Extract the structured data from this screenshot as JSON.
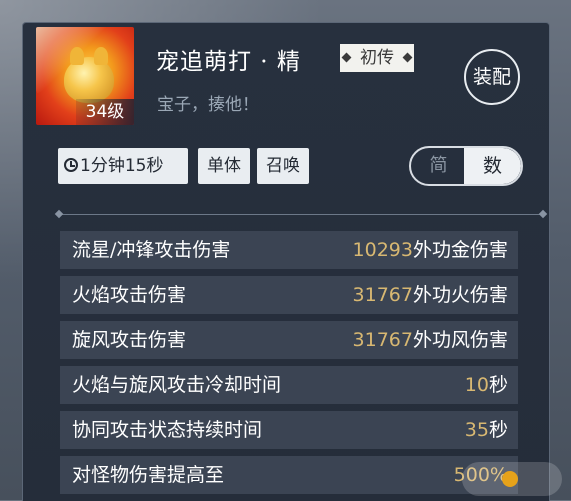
{
  "skill": {
    "level": "34级",
    "name": "宠追萌打 · 精",
    "tag": "初传",
    "description": "宝子，揍他！",
    "equip_button": "装配",
    "portrait_icon": "golden-pet-portrait"
  },
  "chips": {
    "cooldown": "1分钟15秒",
    "target": "单体",
    "type": "召唤"
  },
  "display_toggle": {
    "options": [
      "简",
      "数"
    ],
    "selected": "数"
  },
  "stats": [
    {
      "label": "流星/冲锋攻击伤害",
      "value": "10293",
      "unit": "外功金伤害"
    },
    {
      "label": "火焰攻击伤害",
      "value": "31767",
      "unit": "外功火伤害"
    },
    {
      "label": "旋风攻击伤害",
      "value": "31767",
      "unit": "外功风伤害"
    },
    {
      "label": "火焰与旋风攻击冷却时间",
      "value": "10",
      "unit": "秒"
    },
    {
      "label": "协同攻击状态持续时间",
      "value": "35",
      "unit": "秒"
    },
    {
      "label": "对怪物伤害提高至",
      "value": "500%",
      "unit": ""
    }
  ],
  "colors": {
    "panel_bg": "#27303e",
    "row_bg": "#3b4453",
    "value_gold": "#d8b872"
  }
}
